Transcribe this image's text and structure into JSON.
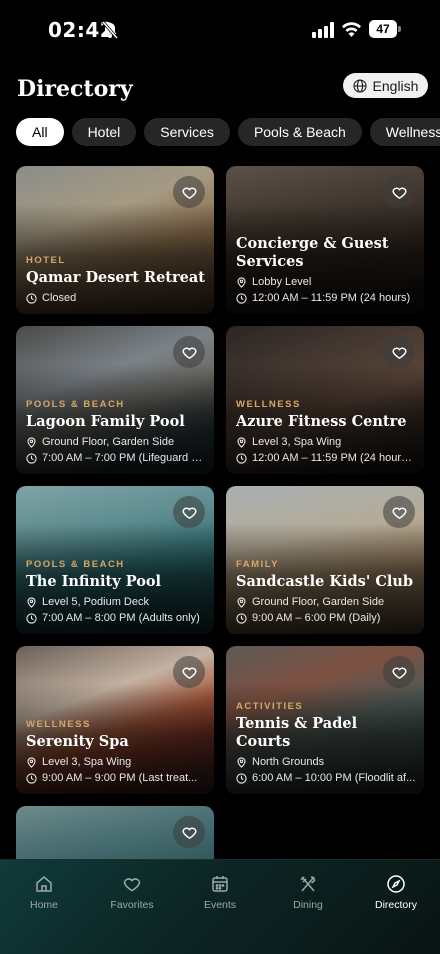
{
  "status_bar": {
    "time": "02:42",
    "battery": "47"
  },
  "header": {
    "title": "Directory",
    "language_label": "English"
  },
  "filters": [
    "All",
    "Hotel",
    "Services",
    "Pools & Beach",
    "Wellness"
  ],
  "cards": [
    {
      "category": "HOTEL",
      "title": "Qamar Desert Retreat",
      "hours": "Closed"
    },
    {
      "category": "",
      "title": "Concierge & Guest Services",
      "location": "Lobby Level",
      "hours": "12:00 AM – 11:59 PM (24 hours)"
    },
    {
      "category": "POOLS & BEACH",
      "title": "Lagoon Family Pool",
      "location": "Ground Floor, Garden Side",
      "hours": "7:00 AM – 7:00 PM (Lifeguard o..."
    },
    {
      "category": "WELLNESS",
      "title": "Azure Fitness Centre",
      "location": "Level 3, Spa Wing",
      "hours": "12:00 AM – 11:59 PM (24 hours,..."
    },
    {
      "category": "POOLS & BEACH",
      "title": "The Infinity Pool",
      "location": "Level 5, Podium Deck",
      "hours": "7:00 AM – 8:00 PM (Adults only)"
    },
    {
      "category": "FAMILY",
      "title": "Sandcastle Kids' Club",
      "location": "Ground Floor, Garden Side",
      "hours": "9:00 AM – 6:00 PM (Daily)"
    },
    {
      "category": "WELLNESS",
      "title": "Serenity Spa",
      "location": "Level 3, Spa Wing",
      "hours": "9:00 AM – 9:00 PM (Last treat..."
    },
    {
      "category": "ACTIVITIES",
      "title": "Tennis & Padel Courts",
      "location": "North Grounds",
      "hours": "6:00 AM – 10:00 PM (Floodlit af..."
    }
  ],
  "nav": [
    {
      "label": "Home",
      "icon": "home-icon"
    },
    {
      "label": "Favorites",
      "icon": "heart-icon"
    },
    {
      "label": "Events",
      "icon": "calendar-icon"
    },
    {
      "label": "Dining",
      "icon": "fork-knife-icon"
    },
    {
      "label": "Directory",
      "icon": "compass-icon",
      "active": true
    }
  ],
  "colors": {
    "accent_category": "#d6a867",
    "nav_gradient": "#0f3b3a",
    "chip_bg": "#262626"
  }
}
